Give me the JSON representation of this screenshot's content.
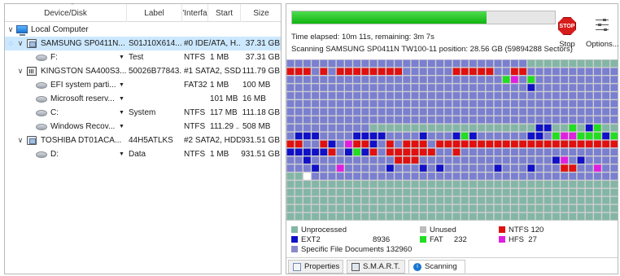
{
  "columns": {
    "device": "Device/Disk",
    "label": "Label",
    "interface": "'Interfa",
    "start": "Start",
    "size": "Size"
  },
  "rows": [
    {
      "name": "Local Computer",
      "label": "",
      "interface": "",
      "start": "",
      "size": ""
    },
    {
      "name": "SAMSUNG SP0411N...",
      "label": "S01J10X614...",
      "interface": "#0 IDE/ATA, H...",
      "start": "",
      "size": "37.31 GB"
    },
    {
      "name": "F:",
      "label": "Test",
      "interface": "NTFS",
      "start": "1 MB",
      "size": "37.31 GB"
    },
    {
      "name": "KINGSTON SA400S3...",
      "label": "50026B77843...",
      "interface": "#1 SATA2, SSD",
      "start": "",
      "size": "111.79 GB"
    },
    {
      "name": "EFI system parti...",
      "label": "",
      "interface": "FAT32",
      "start": "1 MB",
      "size": "100 MB"
    },
    {
      "name": "Microsoft reserv...",
      "label": "",
      "interface": "",
      "start": "101 MB",
      "size": "16 MB"
    },
    {
      "name": "C:",
      "label": "System",
      "interface": "NTFS",
      "start": "117 MB",
      "size": "111.18 GB"
    },
    {
      "name": "Windows Recov...",
      "label": "",
      "interface": "NTFS",
      "start": "111.29 ...",
      "size": "508 MB"
    },
    {
      "name": "TOSHIBA DT01ACA...",
      "label": "44H5ATLKS",
      "interface": "#2 SATA2, HDD",
      "start": "",
      "size": "931.51 GB"
    },
    {
      "name": "D:",
      "label": "Data",
      "interface": "NTFS",
      "start": "1 MB",
      "size": "931.51 GB"
    }
  ],
  "scan": {
    "progress": 0.74,
    "elapsed_text": "Time elapsed: 10m 11s, remaining: 3m 7s",
    "status_text": "Scanning SAMSUNG SP0411N TW100-11 position: 28.56 GB (59894288 Sectors)",
    "stop_label": "Stop",
    "stop_sign_text": "STOP",
    "options_label": "Options..."
  },
  "legend": {
    "unprocessed": "Unprocessed",
    "unused": "Unused",
    "ntfs": "NTFS",
    "ntfs_count": "120",
    "ext2": "EXT2",
    "ext2_count": "8936",
    "fat": "FAT",
    "fat_count": "232",
    "hfs": "HFS",
    "hfs_count": "27",
    "specific": "Specific File Documents",
    "specific_count": "132960"
  },
  "colors": {
    "processed": "#7a7fd0",
    "unprocessed": "#83b6a6",
    "unused": "#bcbcbc",
    "ntfs": "#e01010",
    "ext2": "#1010c8",
    "fat": "#22dd22",
    "hfs": "#e020e0",
    "specific": "#8a88cc",
    "accent": "#1a75d2"
  },
  "tabs": [
    "Properties",
    "S.M.A.R.T.",
    "Scanning"
  ]
}
